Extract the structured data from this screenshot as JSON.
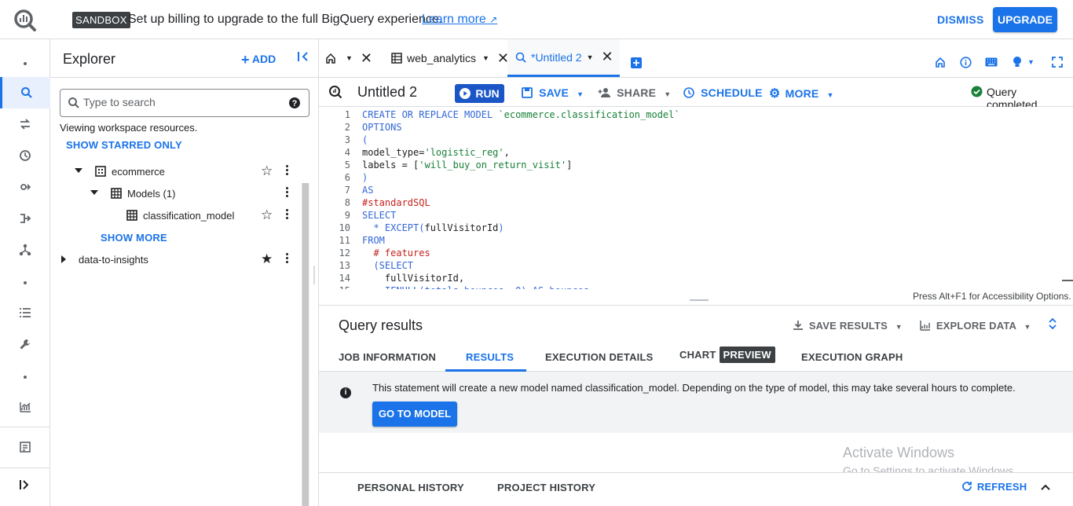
{
  "banner": {
    "badge": "SANDBOX",
    "text": "Set up billing to upgrade to the full BigQuery experience.",
    "learn_more": "Learn more",
    "dismiss": "DISMISS",
    "upgrade": "UPGRADE"
  },
  "explorer": {
    "title": "Explorer",
    "add_label": "ADD",
    "search_placeholder": "Type to search",
    "viewing_text": "Viewing workspace resources.",
    "show_starred": "SHOW STARRED ONLY",
    "tree": {
      "ecommerce": "ecommerce",
      "models": "Models (1)",
      "model_item": "classification_model",
      "show_more": "SHOW MORE",
      "data_to_insights": "data-to-insights"
    }
  },
  "tabs": {
    "web_analytics": "web_analytics",
    "untitled": "*Untitled 2"
  },
  "toolbar": {
    "query_title": "Untitled 2",
    "run": "RUN",
    "save": "SAVE",
    "share": "SHARE",
    "schedule": "SCHEDULE",
    "more": "MORE",
    "status": "Query completed."
  },
  "editor": {
    "accessibility": "Press Alt+F1 for Accessibility Options."
  },
  "results": {
    "title": "Query results",
    "save_results": "SAVE RESULTS",
    "explore_data": "EXPLORE DATA",
    "tabs": {
      "job_information": "JOB INFORMATION",
      "results": "RESULTS",
      "execution_details": "EXECUTION DETAILS",
      "chart": "CHART",
      "preview": "PREVIEW",
      "execution_graph": "EXECUTION GRAPH"
    },
    "info_text": "This statement will create a new model named classification_model. Depending on the type of model, this may take several hours to complete.",
    "go_to_model": "GO TO MODEL"
  },
  "watermark": {
    "line1": "Activate Windows",
    "line2": "Go to Settings to activate Windows."
  },
  "bottom": {
    "personal_history": "PERSONAL HISTORY",
    "project_history": "PROJECT HISTORY",
    "refresh": "REFRESH"
  },
  "colors": {
    "accent": "#1a73e8",
    "run_button": "#1a56c5",
    "status_green": "#188038"
  }
}
